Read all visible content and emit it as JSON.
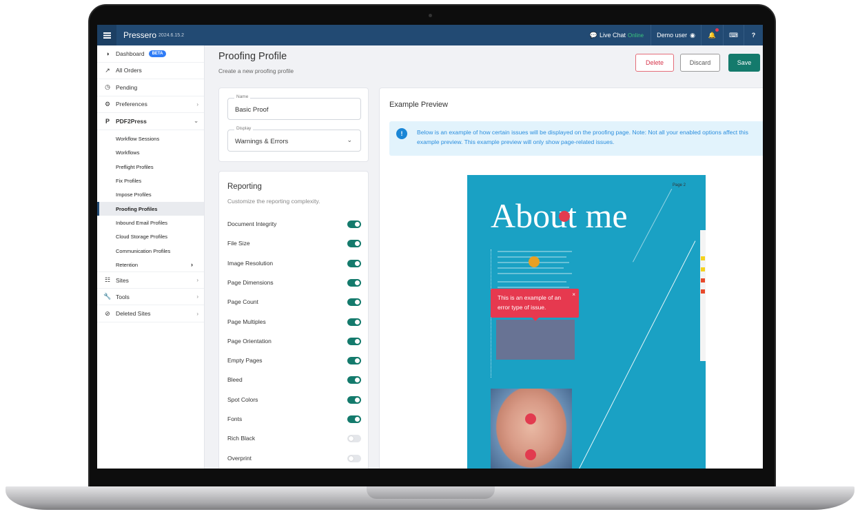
{
  "topbar": {
    "brand": "Pressero",
    "version": "2024.6.15.2",
    "live_chat": "Live Chat",
    "online": "Online",
    "user": "Demo user"
  },
  "sidebar": {
    "items": [
      {
        "label": "Dashboard",
        "badge": "BETA",
        "icon": "dashboard-icon"
      },
      {
        "label": "All Orders",
        "icon": "chart-line-icon"
      },
      {
        "label": "Pending",
        "icon": "clock-icon"
      },
      {
        "label": "Preferences",
        "icon": "gears-icon"
      },
      {
        "label": "PDF2Press",
        "icon": "pdf2press-icon"
      }
    ],
    "sub_items": [
      "Workflow Sessions",
      "Workflows",
      "Preflight Profiles",
      "Fix Profiles",
      "Impose Profiles",
      "Proofing Profiles",
      "Inbound Email Profiles",
      "Cloud Storage Profiles",
      "Communication Profiles",
      "Retention"
    ],
    "bottom_items": [
      {
        "label": "Sites",
        "icon": "sitemap-icon"
      },
      {
        "label": "Tools",
        "icon": "wrench-icon"
      },
      {
        "label": "Deleted Sites",
        "icon": "ban-icon"
      }
    ]
  },
  "header": {
    "title": "Proofing Profile",
    "subtitle": "Create a new proofing profile",
    "delete_label": "Delete",
    "discard_label": "Discard",
    "save_label": "Save"
  },
  "form": {
    "name_label": "Name",
    "name_value": "Basic Proof",
    "display_label": "Display",
    "display_value": "Warnings & Errors"
  },
  "reporting": {
    "title": "Reporting",
    "subtitle": "Customize the reporting complexity.",
    "options": [
      {
        "label": "Document Integrity",
        "enabled": true
      },
      {
        "label": "File Size",
        "enabled": true
      },
      {
        "label": "Image Resolution",
        "enabled": true
      },
      {
        "label": "Page Dimensions",
        "enabled": true
      },
      {
        "label": "Page Count",
        "enabled": true
      },
      {
        "label": "Page Multiples",
        "enabled": true
      },
      {
        "label": "Page Orientation",
        "enabled": true
      },
      {
        "label": "Empty Pages",
        "enabled": true
      },
      {
        "label": "Bleed",
        "enabled": true
      },
      {
        "label": "Spot Colors",
        "enabled": true
      },
      {
        "label": "Fonts",
        "enabled": true
      },
      {
        "label": "Rich Black",
        "enabled": false
      },
      {
        "label": "Overprint",
        "enabled": false
      }
    ]
  },
  "preview": {
    "title": "Example Preview",
    "info": "Below is an example of how certain issues will be displayed on the proofing page. Note: Not all your enabled options affect this example preview. This example preview will only show page-related issues.",
    "doc_page_label": "Page 2",
    "doc_heading": "About me",
    "tooltip_text": "This is an example of an error type of issue.",
    "tooltip_close": "×"
  },
  "colors": {
    "topbar": "#224a73",
    "accent": "#147a6c",
    "danger": "#d6334a",
    "info": "#2a8ddd",
    "doc_bg": "#1aa1c4"
  }
}
